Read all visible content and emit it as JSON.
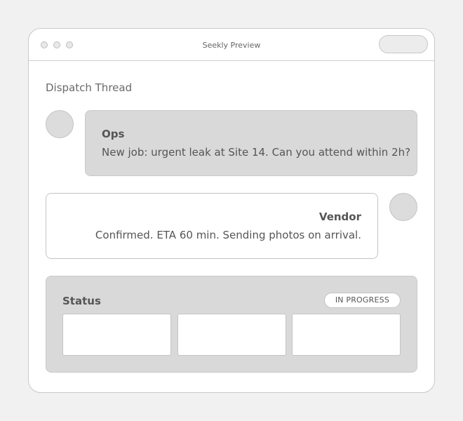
{
  "window": {
    "title": "Seekly Preview"
  },
  "thread": {
    "title": "Dispatch Thread",
    "messages": [
      {
        "sender": "Ops",
        "text": "New job: urgent leak at Site 14. Can you attend within 2h?",
        "style": "filled"
      },
      {
        "sender": "Vendor",
        "text": "Confirmed. ETA 60 min. Sending photos on arrival.",
        "style": "outline"
      }
    ]
  },
  "status": {
    "label": "Status",
    "badge": "IN PROGRESS"
  }
}
